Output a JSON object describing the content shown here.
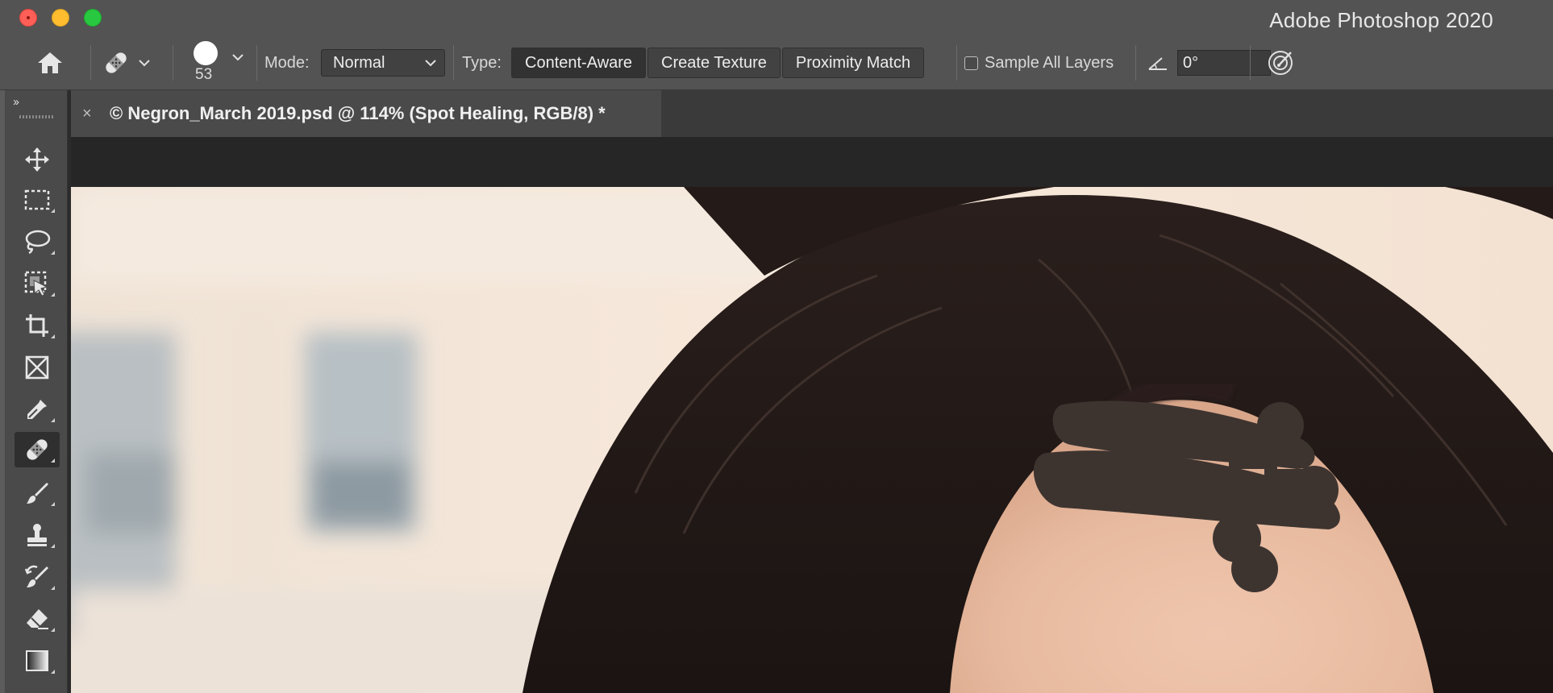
{
  "window": {
    "app_title": "Adobe Photoshop 2020"
  },
  "options_bar": {
    "brush_size": "53",
    "mode_label": "Mode:",
    "mode_value": "Normal",
    "type_label": "Type:",
    "type_options": [
      "Content-Aware",
      "Create Texture",
      "Proximity Match"
    ],
    "selected_type": "Content-Aware",
    "sample_all_layers_label": "Sample All Layers",
    "sample_all_layers_checked": false,
    "angle_value": "0°"
  },
  "document": {
    "tab_title": "© Negron_March 2019.psd @ 114% (Spot Healing, RGB/8) *",
    "close_glyph": "×"
  },
  "tools": [
    {
      "name": "move-tool",
      "icon": "move-icon"
    },
    {
      "name": "rectangular-marquee-tool",
      "icon": "marquee-icon"
    },
    {
      "name": "lasso-tool",
      "icon": "lasso-icon"
    },
    {
      "name": "object-selection-tool",
      "icon": "object-selection-icon"
    },
    {
      "name": "crop-tool",
      "icon": "crop-icon"
    },
    {
      "name": "frame-tool",
      "icon": "frame-icon"
    },
    {
      "name": "eyedropper-tool",
      "icon": "eyedropper-icon"
    },
    {
      "name": "spot-healing-brush-tool",
      "icon": "bandage-icon",
      "selected": true
    },
    {
      "name": "brush-tool",
      "icon": "brush-icon"
    },
    {
      "name": "clone-stamp-tool",
      "icon": "stamp-icon"
    },
    {
      "name": "history-brush-tool",
      "icon": "history-brush-icon"
    },
    {
      "name": "eraser-tool",
      "icon": "eraser-icon"
    },
    {
      "name": "gradient-tool",
      "icon": "gradient-icon"
    }
  ],
  "colors": {
    "ui_panel": "#535353",
    "selected_tool": "#2f2f2f",
    "heal_stroke": "#3d3430"
  }
}
